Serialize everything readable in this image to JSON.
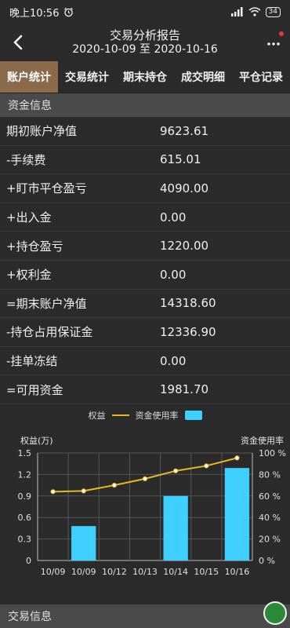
{
  "status": {
    "time": "晚上10:56",
    "battery": "34"
  },
  "header": {
    "title": "交易分析报告",
    "date_range": "2020-10-09 至 2020-10-16"
  },
  "tabs": [
    {
      "label": "账户统计",
      "active": true
    },
    {
      "label": "交易统计",
      "active": false
    },
    {
      "label": "期末持仓",
      "active": false
    },
    {
      "label": "成交明细",
      "active": false
    },
    {
      "label": "平仓记录",
      "active": false
    }
  ],
  "funds_section": {
    "title": "资金信息"
  },
  "funds": [
    {
      "label": "期初账户净值",
      "value": "9623.61"
    },
    {
      "label": "-手续费",
      "value": "615.01"
    },
    {
      "label": "+盯市平仓盈亏",
      "value": "4090.00"
    },
    {
      "label": "+出入金",
      "value": "0.00"
    },
    {
      "label": "+持仓盈亏",
      "value": "1220.00"
    },
    {
      "label": "+权利金",
      "value": "0.00"
    },
    {
      "label": "=期末账户净值",
      "value": "14318.60"
    },
    {
      "label": "-持仓占用保证金",
      "value": "12336.90"
    },
    {
      "label": "-挂单冻结",
      "value": "0.00"
    },
    {
      "label": "=可用资金",
      "value": "1981.70"
    }
  ],
  "chart_labels": {
    "left_axis_title": "权益(万)",
    "right_axis_title": "资金使用率"
  },
  "chart_data": {
    "type": "bar+line",
    "categories": [
      "10/09",
      "10/09",
      "10/12",
      "10/13",
      "10/14",
      "10/15",
      "10/16"
    ],
    "series": [
      {
        "name": "权益",
        "type": "line",
        "axis": "left",
        "color": "#e6b822",
        "values": [
          0.96,
          0.97,
          1.05,
          1.14,
          1.25,
          1.32,
          1.43
        ]
      },
      {
        "name": "资金使用率",
        "type": "bar",
        "axis": "right",
        "color": "#3fd0ff",
        "values": [
          0,
          32,
          0,
          0,
          60,
          0,
          86
        ]
      }
    ],
    "y_left": {
      "min": 0,
      "max": 1.5,
      "ticks": [
        "0",
        "0.3",
        "0.6",
        "0.9",
        "1.2",
        "1.5"
      ]
    },
    "y_right": {
      "min": 0,
      "max": 100,
      "ticks": [
        "0 %",
        "20 %",
        "40 %",
        "60 %",
        "80 %",
        "100 %"
      ]
    },
    "grid": true,
    "legend_position": "top-center"
  },
  "trade_section": {
    "title": "交易信息"
  },
  "colors": {
    "accent_tab": "#8a6a4a",
    "line": "#e6b822",
    "bar": "#3fd0ff",
    "background": "#2b2b2b"
  }
}
